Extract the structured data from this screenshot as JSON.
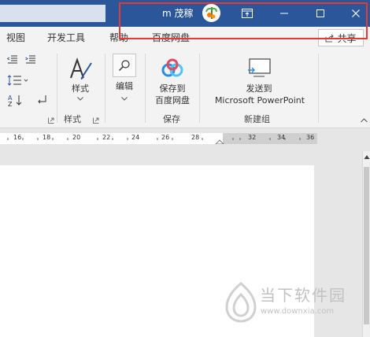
{
  "titlebar": {
    "user_name": "m 茂稼",
    "colors": {
      "bar": "#2b579a",
      "highlight": "#e53935"
    }
  },
  "tabs": [
    {
      "label": "视图"
    },
    {
      "label": "开发工具"
    },
    {
      "label": "帮助"
    },
    {
      "label": "百度网盘"
    }
  ],
  "share_label": "共享",
  "ribbon": {
    "styles_label": "样式",
    "styles_group": "样式",
    "editing_label": "编辑",
    "save_label_1": "保存到",
    "save_label_2": "百度网盘",
    "save_group": "保存",
    "send_label_1": "发送到",
    "send_label_2": "Microsoft PowerPoint",
    "new_group": "新建组"
  },
  "ruler": {
    "ticks": [
      "16",
      "18",
      "20",
      "22",
      "24",
      "26",
      "28",
      "32",
      "34",
      "36"
    ]
  },
  "watermark": {
    "text": "当下软件园",
    "url": "www.downxia.com"
  }
}
